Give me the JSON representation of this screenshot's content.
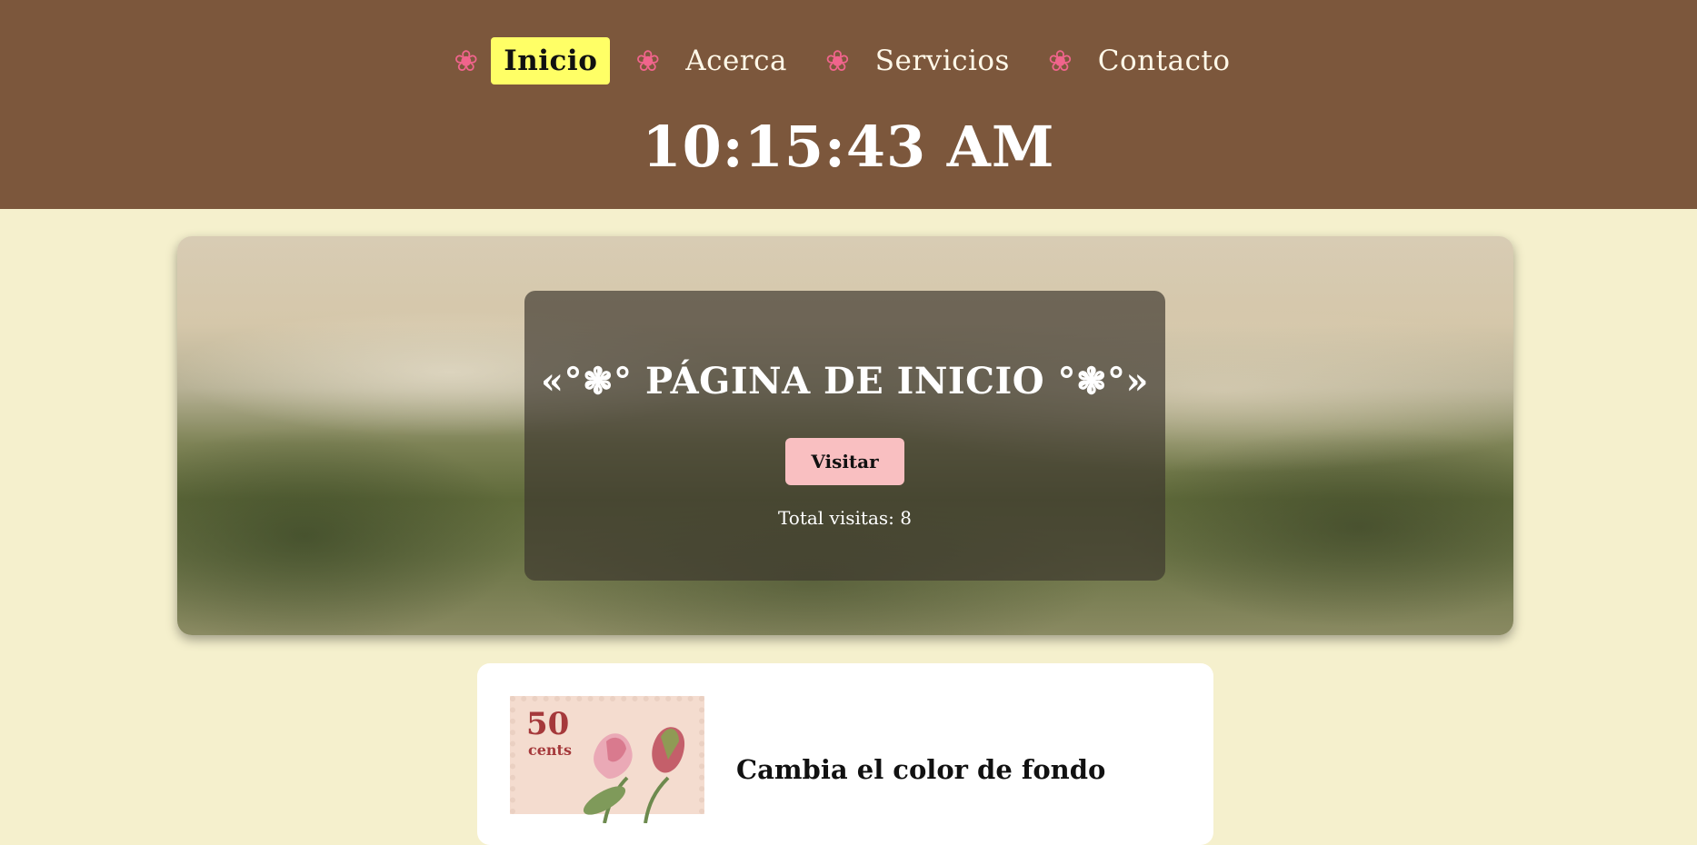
{
  "nav": {
    "items": [
      {
        "label": "Inicio",
        "icon": "flower-icon",
        "active": true
      },
      {
        "label": "Acerca",
        "icon": "flower-icon",
        "active": false
      },
      {
        "label": "Servicios",
        "icon": "flower-icon",
        "active": false
      },
      {
        "label": "Contacto",
        "icon": "flower-icon",
        "active": false
      }
    ],
    "flower_glyph": "❀"
  },
  "clock": {
    "time": "10:15:43 AM"
  },
  "hero": {
    "title": "«°❃° PÁGINA DE INICIO °❃°»",
    "button_label": "Visitar",
    "visits_text": "Total visitas: 8"
  },
  "card": {
    "stamp_value": "50",
    "stamp_unit": "cents",
    "title": "Cambia el color de fondo"
  },
  "colors": {
    "header_bg": "#7c573c",
    "page_bg": "#f5f0cd",
    "active_nav_bg": "#ffff66",
    "flower_icon": "#f0648c",
    "button_bg": "#f9bfc1"
  }
}
